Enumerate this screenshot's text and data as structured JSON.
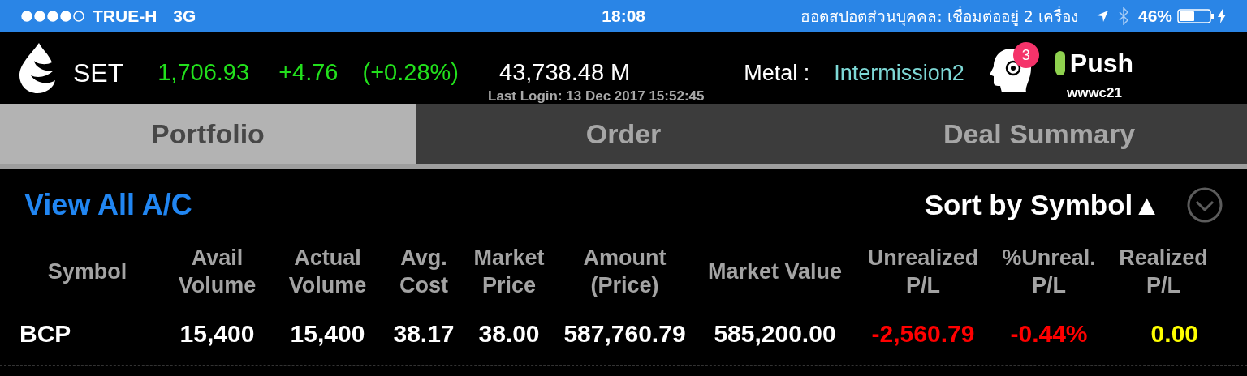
{
  "status_bar": {
    "carrier": "TRUE-H",
    "network": "3G",
    "time": "18:08",
    "hotspot": "ฮอตสปอตส่วนบุคคล: เชื่อมต่ออยู่ 2 เครื่อง",
    "battery": "46%"
  },
  "header": {
    "index": "SET",
    "value": "1,706.93",
    "change": "+4.76",
    "percent": "(+0.28%)",
    "volume": "43,738.48 M",
    "last_login": "Last Login: 13 Dec 2017 15:52:45",
    "market_label": "Metal :",
    "market_status": "Intermission2",
    "badge": "3",
    "push": "Push",
    "push_on": true,
    "user": "wwwc21"
  },
  "tabs": [
    {
      "label": "Portfolio",
      "selected": true
    },
    {
      "label": "Order",
      "selected": false
    },
    {
      "label": "Deal Summary",
      "selected": false
    }
  ],
  "view_all": "View All A/C",
  "sort": "Sort by Symbol▲",
  "table": {
    "columns": [
      "Symbol",
      "Avail Volume",
      "Actual Volume",
      "Avg. Cost",
      "Market Price",
      "Amount (Price)",
      "Market Value",
      "Unrealized P/L",
      "%Unreal. P/L",
      "Realized P/L"
    ],
    "rows": [
      [
        {
          "text": "BCP",
          "color": "#ffffff"
        },
        {
          "text": "15,400",
          "color": "#ffffff"
        },
        {
          "text": "15,400",
          "color": "#ffffff"
        },
        {
          "text": "38.17",
          "color": "#ffffff"
        },
        {
          "text": "38.00",
          "color": "#ffffff"
        },
        {
          "text": "587,760.79",
          "color": "#ffffff"
        },
        {
          "text": "585,200.00",
          "color": "#ffffff"
        },
        {
          "text": "-2,560.79",
          "color": "#ff0000"
        },
        {
          "text": "-0.44%",
          "color": "#ff0000"
        },
        {
          "text": "0.00",
          "color": "#ffff00"
        }
      ]
    ]
  }
}
